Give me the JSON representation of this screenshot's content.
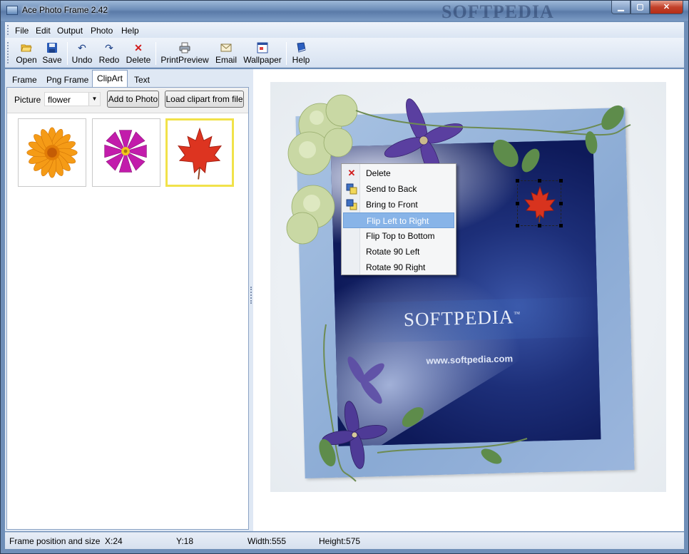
{
  "window": {
    "title": "Ace Photo Frame 2.42",
    "watermark": "SOFTPEDIA",
    "controls": [
      "minimize",
      "maximize",
      "close"
    ]
  },
  "menu": [
    "File",
    "Edit",
    "Output",
    "Photo",
    "Help"
  ],
  "toolbar": [
    {
      "label": "Open",
      "icon": "open-folder-icon"
    },
    {
      "label": "Save",
      "icon": "save-disk-icon"
    },
    {
      "label": "Undo",
      "icon": "undo-icon"
    },
    {
      "label": "Redo",
      "icon": "redo-icon"
    },
    {
      "label": "Delete",
      "icon": "delete-x-icon"
    },
    {
      "label": "PrintPreview",
      "icon": "printer-icon"
    },
    {
      "label": "Email",
      "icon": "email-icon"
    },
    {
      "label": "Wallpaper",
      "icon": "wallpaper-icon"
    },
    {
      "label": "Help",
      "icon": "help-book-icon"
    }
  ],
  "tabs": [
    "Frame",
    "Png Frame",
    "ClipArt",
    "Text"
  ],
  "active_tab": "ClipArt",
  "clipart": {
    "picture_label": "Picture",
    "picture_value": "flower",
    "add_button": "Add to Photo",
    "load_button": "Load clipart from file",
    "thumbnails": [
      {
        "name": "orange-flower",
        "selected": false
      },
      {
        "name": "magenta-flower",
        "selected": false
      },
      {
        "name": "red-maple-leaf",
        "selected": true
      }
    ]
  },
  "photo": {
    "brand": "SOFTPEDIA",
    "trademark": "™",
    "url": "www.softpedia.com"
  },
  "context_menu": [
    {
      "label": "Delete",
      "icon": "delete-x-icon",
      "highlighted": false
    },
    {
      "label": "Send to Back",
      "icon": "send-to-back-icon",
      "highlighted": false
    },
    {
      "label": "Bring to Front",
      "icon": "bring-to-front-icon",
      "highlighted": false
    },
    {
      "label": "Flip Left to Right",
      "icon": "",
      "highlighted": true
    },
    {
      "label": "Flip Top to Bottom",
      "icon": "",
      "highlighted": false
    },
    {
      "label": "Rotate 90 Left",
      "icon": "",
      "highlighted": false
    },
    {
      "label": "Rotate 90 Right",
      "icon": "",
      "highlighted": false
    }
  ],
  "status": {
    "label": "Frame position and size",
    "x": "X:24",
    "y": "Y:18",
    "width": "Width:555",
    "height": "Height:575"
  },
  "colors": {
    "menu_highlight": "#88b4e8",
    "thumb_selected_border": "#f1e24a",
    "frame_blue": "#8aaad4"
  }
}
